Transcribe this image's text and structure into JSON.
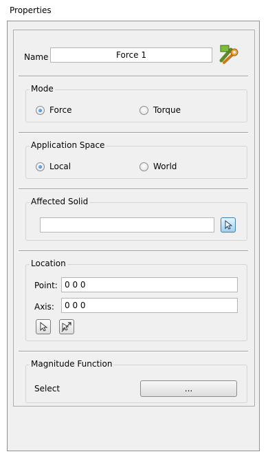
{
  "panel": {
    "title": "Properties"
  },
  "name_field": {
    "label": "Name",
    "value": "Force 1",
    "icon": "wrench-tool-icon"
  },
  "mode": {
    "legend": "Mode",
    "options": [
      {
        "label": "Force",
        "selected": true
      },
      {
        "label": "Torque",
        "selected": false
      }
    ]
  },
  "application_space": {
    "legend": "Application Space",
    "options": [
      {
        "label": "Local",
        "selected": true
      },
      {
        "label": "World",
        "selected": false
      }
    ]
  },
  "affected_solid": {
    "legend": "Affected Solid",
    "value": "",
    "pick_icon": "pick-cursor-icon"
  },
  "location": {
    "legend": "Location",
    "point_label": "Point:",
    "point_value": "0 0 0",
    "axis_label": "Axis:",
    "axis_value": "0 0 0",
    "pick_icon": "pick-cursor-icon",
    "axis_pick_icon": "axis-pick-icon"
  },
  "magnitude": {
    "legend": "Magnitude Function",
    "select_label": "Select",
    "button_label": "..."
  },
  "colors": {
    "panel_bg": "#f0f0f0",
    "radio_selected": "#1a64c8",
    "pick_button": "#9ed0f2"
  }
}
